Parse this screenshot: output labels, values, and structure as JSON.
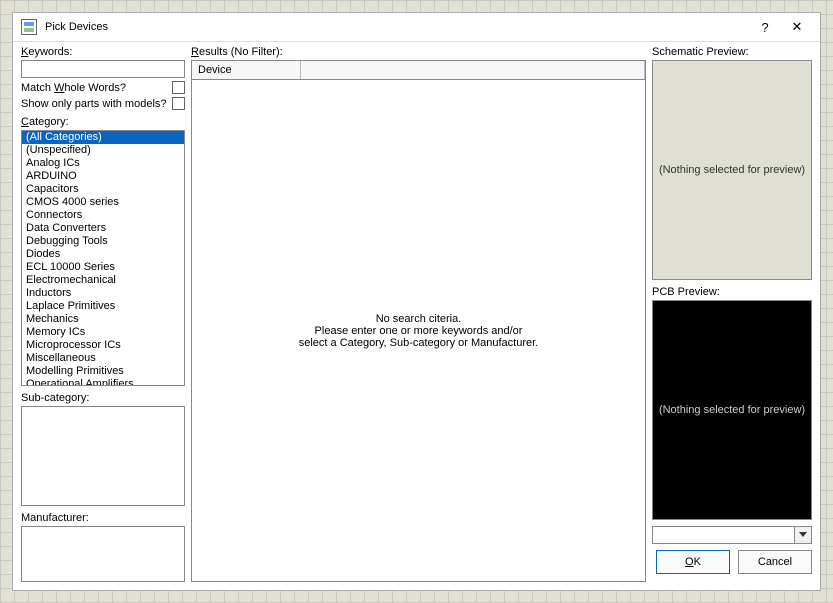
{
  "titlebar": {
    "title": "Pick Devices",
    "help": "?",
    "close": "✕"
  },
  "left": {
    "keywords_label": "Keywords",
    "keywords_value": "",
    "match_whole_label": "Match Whole Words?",
    "models_only_label": "Show only parts with models?",
    "category_label": "Category",
    "categories": [
      "(All Categories)",
      "(Unspecified)",
      "Analog ICs",
      "ARDUINO",
      "Capacitors",
      "CMOS 4000 series",
      "Connectors",
      "Data Converters",
      "Debugging Tools",
      "Diodes",
      "ECL 10000 Series",
      "Electromechanical",
      "Inductors",
      "Laplace Primitives",
      "Mechanics",
      "Memory ICs",
      "Microprocessor ICs",
      "Miscellaneous",
      "Modelling Primitives",
      "Operational Amplifiers"
    ],
    "subcategory_label": "Sub-category:",
    "manufacturer_label": "Manufacturer:"
  },
  "mid": {
    "header": "Results (No Filter):",
    "col_device": "Device",
    "body_line1": "No search citeria.",
    "body_line2": "Please enter one or more keywords and/or",
    "body_line3": "select a Category, Sub-category or Manufacturer."
  },
  "right": {
    "schem_label": "Schematic Preview:",
    "schem_msg": "(Nothing selected for preview)",
    "pcb_label": "PCB Preview:",
    "pcb_msg": "(Nothing selected for preview)",
    "ok": "OK",
    "cancel": "Cancel"
  }
}
